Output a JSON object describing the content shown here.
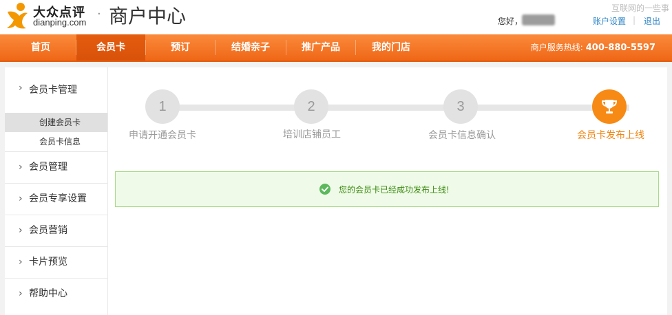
{
  "header": {
    "logo_cn": "大众点评",
    "logo_en": "dianping.com",
    "title_separator": "·",
    "title": "商户中心",
    "watermark": "互联网的一些事",
    "greeting": "您好，",
    "account_settings": "账户设置",
    "separator": "|",
    "logout": "退出"
  },
  "nav": {
    "items": [
      {
        "label": "首页"
      },
      {
        "label": "会员卡"
      },
      {
        "label": "预订"
      },
      {
        "label": "结婚亲子"
      },
      {
        "label": "推广产品"
      },
      {
        "label": "我的门店"
      }
    ],
    "active_index": 1,
    "hotline_label": "商户服务热线:",
    "hotline_number": "400-880-5597"
  },
  "sidebar": {
    "section_title": "会员卡管理",
    "sub_items": [
      {
        "label": "创建会员卡",
        "active": true
      },
      {
        "label": "会员卡信息",
        "active": false
      }
    ],
    "items": [
      {
        "label": "会员管理"
      },
      {
        "label": "会员专享设置"
      },
      {
        "label": "会员营销"
      },
      {
        "label": "卡片预览"
      },
      {
        "label": "帮助中心"
      }
    ],
    "chevron": "›"
  },
  "steps": [
    {
      "number": "1",
      "label": "申请开通会员卡",
      "status": "pending"
    },
    {
      "number": "2",
      "label": "培训店铺员工",
      "status": "pending"
    },
    {
      "number": "3",
      "label": "会员卡信息确认",
      "status": "pending"
    },
    {
      "number": "",
      "icon": "trophy-icon",
      "label": "会员卡发布上线",
      "status": "done"
    }
  ],
  "message": {
    "icon": "check-circle-icon",
    "text": "您的会员卡已经成功发布上线!"
  },
  "colors": {
    "nav_orange": "#f27422",
    "accent_orange": "#f78a14",
    "link_blue": "#2f86c8",
    "success_green": "#5cb85c",
    "success_bg": "#effbe8"
  }
}
